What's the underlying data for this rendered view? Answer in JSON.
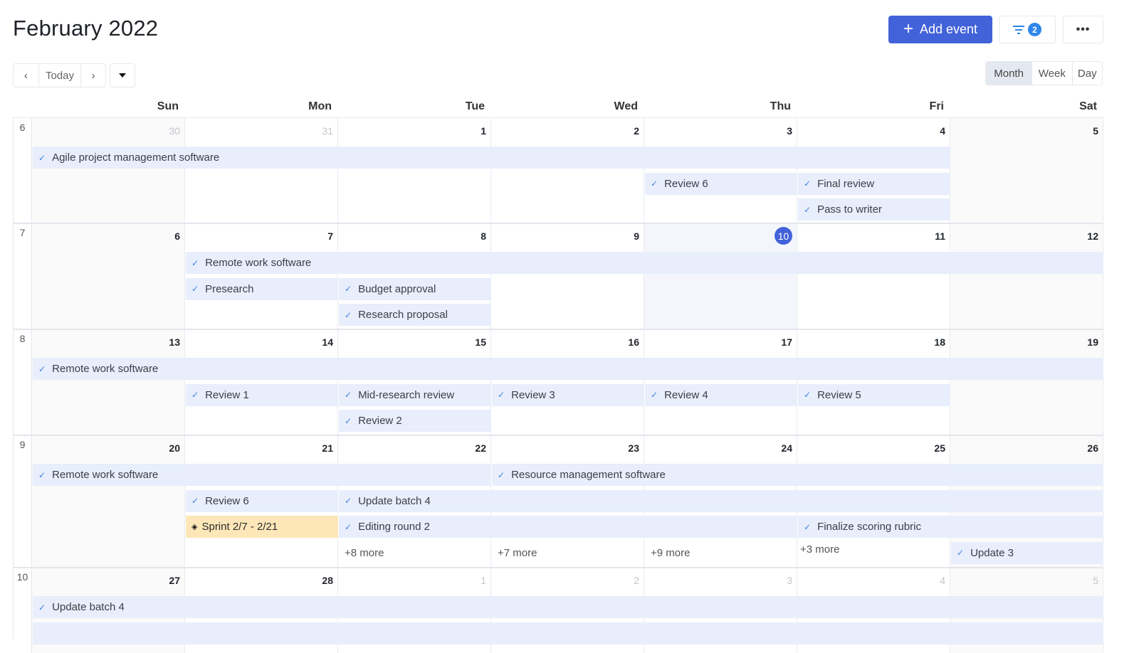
{
  "header": {
    "title": "February 2022",
    "add_event_label": "Add event",
    "add_icon": "plus-icon",
    "filter_icon": "filter-icon",
    "filter_count": "2",
    "more_icon": "more-horizontal-icon",
    "more_label": "•••"
  },
  "nav": {
    "prev_label": "‹",
    "today_label": "Today",
    "next_label": "›",
    "dropdown_icon": "caret-down-icon"
  },
  "views": {
    "month": "Month",
    "week": "Week",
    "day": "Day",
    "selected": "Month"
  },
  "weekdays": [
    "Sun",
    "Mon",
    "Tue",
    "Wed",
    "Thu",
    "Fri",
    "Sat"
  ],
  "today": 10,
  "colors": {
    "accent": "#4262d9",
    "badge": "#2f86eb",
    "event_bg": "#e8eefb",
    "sprint_bg": "#fde7b8",
    "check": "#3f84e5"
  },
  "weeks": [
    {
      "number": "6",
      "days": [
        {
          "label": "30",
          "other": true
        },
        {
          "label": "31",
          "other": true
        },
        {
          "label": "1"
        },
        {
          "label": "2"
        },
        {
          "label": "3"
        },
        {
          "label": "4"
        },
        {
          "label": "5"
        }
      ],
      "events": [
        {
          "title": "Agile project management software",
          "start": 0,
          "end": 5,
          "row": 0,
          "type": "task"
        },
        {
          "title": "Review 6",
          "start": 4,
          "end": 4,
          "row": 1,
          "type": "task"
        },
        {
          "title": "Final review",
          "start": 5,
          "end": 5,
          "row": 1,
          "type": "task"
        },
        {
          "title": "Pass to writer",
          "start": 5,
          "end": 5,
          "row": 2,
          "type": "task"
        }
      ],
      "more": []
    },
    {
      "number": "7",
      "days": [
        {
          "label": "6"
        },
        {
          "label": "7"
        },
        {
          "label": "8"
        },
        {
          "label": "9"
        },
        {
          "label": "10",
          "today": true
        },
        {
          "label": "11"
        },
        {
          "label": "12"
        }
      ],
      "events": [
        {
          "title": "Remote work software",
          "start": 1,
          "end": 6,
          "row": 0,
          "type": "task"
        },
        {
          "title": "Presearch",
          "start": 1,
          "end": 1,
          "row": 1,
          "type": "task"
        },
        {
          "title": "Budget approval",
          "start": 2,
          "end": 2,
          "row": 1,
          "type": "task"
        },
        {
          "title": "Research proposal",
          "start": 2,
          "end": 2,
          "row": 2,
          "type": "task"
        }
      ],
      "more": []
    },
    {
      "number": "8",
      "days": [
        {
          "label": "13"
        },
        {
          "label": "14"
        },
        {
          "label": "15"
        },
        {
          "label": "16"
        },
        {
          "label": "17"
        },
        {
          "label": "18"
        },
        {
          "label": "19"
        }
      ],
      "events": [
        {
          "title": "Remote work software",
          "start": 0,
          "end": 6,
          "row": 0,
          "type": "task"
        },
        {
          "title": "Review 1",
          "start": 1,
          "end": 1,
          "row": 1,
          "type": "task"
        },
        {
          "title": "Mid-research review",
          "start": 2,
          "end": 2,
          "row": 1,
          "type": "task"
        },
        {
          "title": "Review 3",
          "start": 3,
          "end": 3,
          "row": 1,
          "type": "task"
        },
        {
          "title": "Review 4",
          "start": 4,
          "end": 4,
          "row": 1,
          "type": "task"
        },
        {
          "title": "Review 5",
          "start": 5,
          "end": 5,
          "row": 1,
          "type": "task"
        },
        {
          "title": "Review 2",
          "start": 2,
          "end": 2,
          "row": 2,
          "type": "task"
        }
      ],
      "more": []
    },
    {
      "number": "9",
      "days": [
        {
          "label": "20"
        },
        {
          "label": "21"
        },
        {
          "label": "22"
        },
        {
          "label": "23"
        },
        {
          "label": "24"
        },
        {
          "label": "25"
        },
        {
          "label": "26"
        }
      ],
      "events": [
        {
          "title": "Remote work software",
          "start": 0,
          "end": 2,
          "row": 0,
          "type": "task"
        },
        {
          "title": "Resource management software",
          "start": 3,
          "end": 6,
          "row": 0,
          "type": "task"
        },
        {
          "title": "Review 6",
          "start": 1,
          "end": 1,
          "row": 1,
          "type": "task"
        },
        {
          "title": "Update batch 4",
          "start": 2,
          "end": 6,
          "row": 1,
          "type": "task"
        },
        {
          "title": "Sprint 2/7 - 2/21",
          "start": 1,
          "end": 1,
          "row": 2,
          "type": "sprint"
        },
        {
          "title": "Editing round 2",
          "start": 2,
          "end": 4,
          "row": 2,
          "type": "task"
        },
        {
          "title": "Finalize scoring rubric",
          "start": 5,
          "end": 6,
          "row": 2,
          "type": "task"
        },
        {
          "title": "Update 3",
          "start": 6,
          "end": 6,
          "row": 3,
          "type": "task"
        }
      ],
      "more": [
        {
          "day": 2,
          "label": "+8 more"
        },
        {
          "day": 3,
          "label": "+7 more"
        },
        {
          "day": 4,
          "label": "+9 more"
        },
        {
          "day": 5,
          "label": "+3 more"
        }
      ]
    },
    {
      "number": "10",
      "days": [
        {
          "label": "27"
        },
        {
          "label": "28"
        },
        {
          "label": "1",
          "other": true
        },
        {
          "label": "2",
          "other": true
        },
        {
          "label": "3",
          "other": true
        },
        {
          "label": "4",
          "other": true
        },
        {
          "label": "5",
          "other": true
        }
      ],
      "events": [
        {
          "title": "Update batch 4",
          "start": 0,
          "end": 6,
          "row": 0,
          "type": "task"
        },
        {
          "title": "",
          "start": 0,
          "end": 6,
          "row": 1,
          "type": "task"
        }
      ],
      "more": []
    }
  ]
}
